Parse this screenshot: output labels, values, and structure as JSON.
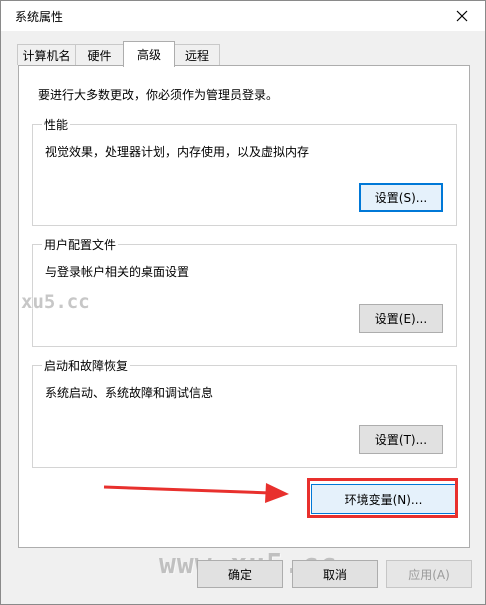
{
  "window": {
    "title": "系统属性"
  },
  "tabs": [
    {
      "label": "计算机名",
      "active": false
    },
    {
      "label": "硬件",
      "active": false
    },
    {
      "label": "高级",
      "active": true
    },
    {
      "label": "远程",
      "active": false
    }
  ],
  "panel": {
    "notice": "要进行大多数更改，你必须作为管理员登录。",
    "performance": {
      "title": "性能",
      "description": "视觉效果，处理器计划，内存使用，以及虚拟内存",
      "button": "设置(S)..."
    },
    "user_profile": {
      "title": "用户配置文件",
      "description": "与登录帐户相关的桌面设置",
      "button": "设置(E)..."
    },
    "startup_recovery": {
      "title": "启动和故障恢复",
      "description": "系统启动、系统故障和调试信息",
      "button": "设置(T)..."
    },
    "env_button": "环境变量(N)..."
  },
  "footer": {
    "ok": "确定",
    "cancel": "取消",
    "apply": "应用(A)"
  },
  "watermarks": {
    "mid": "xu5.cc",
    "bottom": "www.xu5.cc"
  },
  "colors": {
    "annotation_red": "#e8302d",
    "focus_blue": "#0078d7"
  }
}
